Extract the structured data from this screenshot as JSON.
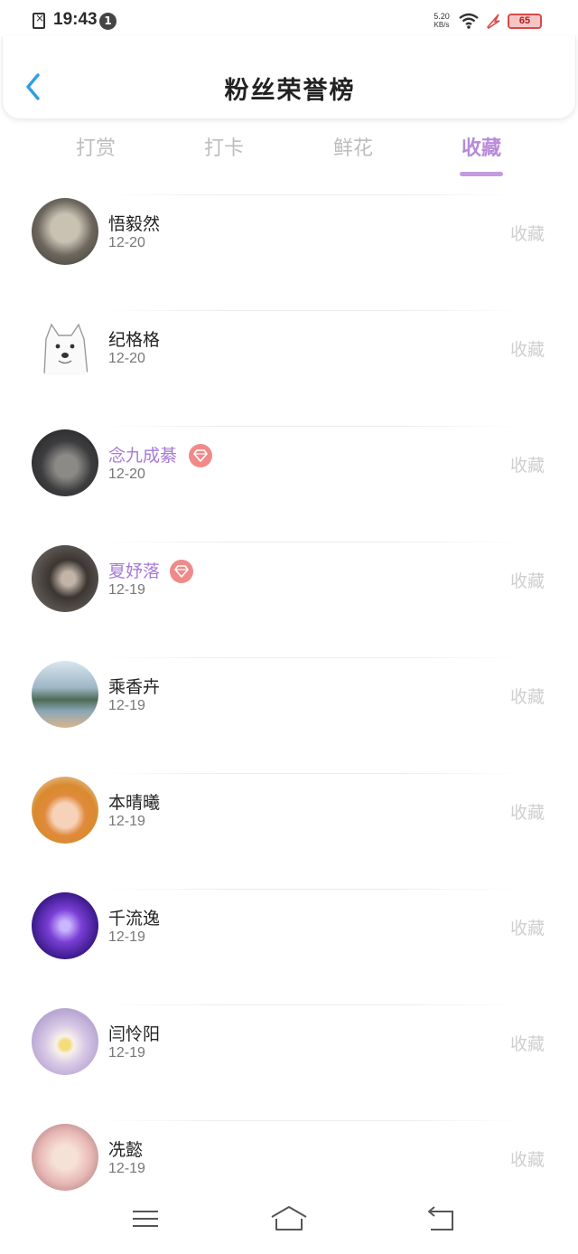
{
  "status_bar": {
    "time": "19:43",
    "notification_count": "1",
    "net_speed_value": "5.20",
    "net_speed_unit": "KB/s",
    "battery_level": "65",
    "icons": [
      "sim-error-icon",
      "wifi-icon",
      "charging-icon",
      "battery-icon"
    ]
  },
  "header": {
    "title": "粉丝荣誉榜",
    "back_icon": "chevron-left-icon"
  },
  "tabs": [
    {
      "label": "打赏",
      "active": false
    },
    {
      "label": "打卡",
      "active": false
    },
    {
      "label": "鲜花",
      "active": false
    },
    {
      "label": "收藏",
      "active": true
    }
  ],
  "fans": [
    {
      "name": "悟毅然",
      "date": "12-20",
      "action": "收藏",
      "vip": false
    },
    {
      "name": "纪格格",
      "date": "12-20",
      "action": "收藏",
      "vip": false
    },
    {
      "name": "念九成綦",
      "date": "12-20",
      "action": "收藏",
      "vip": true
    },
    {
      "name": "夏妤落",
      "date": "12-19",
      "action": "收藏",
      "vip": true
    },
    {
      "name": "乘香卉",
      "date": "12-19",
      "action": "收藏",
      "vip": false
    },
    {
      "name": "本晴曦",
      "date": "12-19",
      "action": "收藏",
      "vip": false
    },
    {
      "name": "千流逸",
      "date": "12-19",
      "action": "收藏",
      "vip": false
    },
    {
      "name": "闫怜阳",
      "date": "12-19",
      "action": "收藏",
      "vip": false
    },
    {
      "name": "冼懿",
      "date": "12-19",
      "action": "收藏",
      "vip": false
    }
  ],
  "colors": {
    "accent": "#b78ad9",
    "vip_name": "#a77ad6",
    "vip_badge": "#f08a8a",
    "back_arrow": "#2f9ee6",
    "inactive_tab": "#bdbdbd"
  },
  "nav_bar": {
    "icons": [
      "menu-icon",
      "home-icon",
      "back-icon"
    ]
  }
}
